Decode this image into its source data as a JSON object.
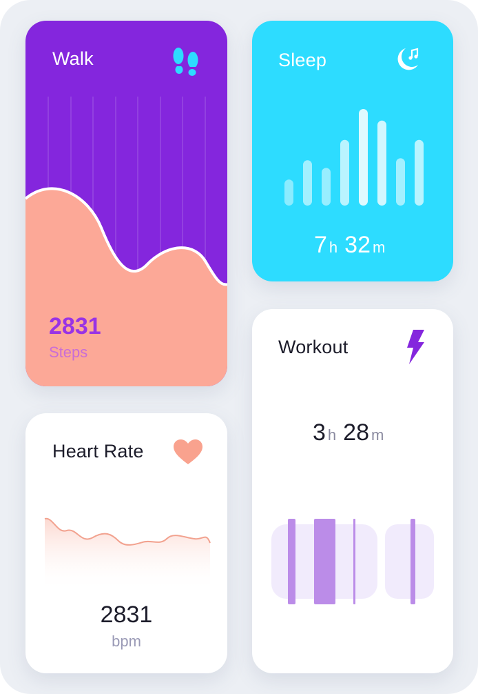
{
  "cards": {
    "walk": {
      "title": "Walk",
      "icon": "footsteps-icon",
      "value": "2831",
      "unit": "Steps",
      "colors": {
        "background": "#8426dd",
        "area": "#fca897",
        "value": "#9933e5"
      }
    },
    "sleep": {
      "title": "Sleep",
      "icon": "moon-music-icon",
      "hours": "7",
      "hours_unit": "h",
      "minutes": "32",
      "minutes_unit": "m",
      "bar_levels": [
        0.27,
        0.47,
        0.39,
        0.68,
        1.0,
        0.88,
        0.49,
        0.68
      ],
      "colors": {
        "background": "#2ddcff"
      }
    },
    "heart_rate": {
      "title": "Heart Rate",
      "icon": "heart-icon",
      "value": "2831",
      "unit": "bpm",
      "colors": {
        "accent": "#f9a28e"
      }
    },
    "workout": {
      "title": "Workout",
      "icon": "lightning-icon",
      "hours": "3",
      "hours_unit": "h",
      "minutes": "28",
      "minutes_unit": "m",
      "colors": {
        "accent": "#8426dd",
        "bar": "#bb8ce8",
        "track": "#f1ebfc"
      }
    }
  }
}
